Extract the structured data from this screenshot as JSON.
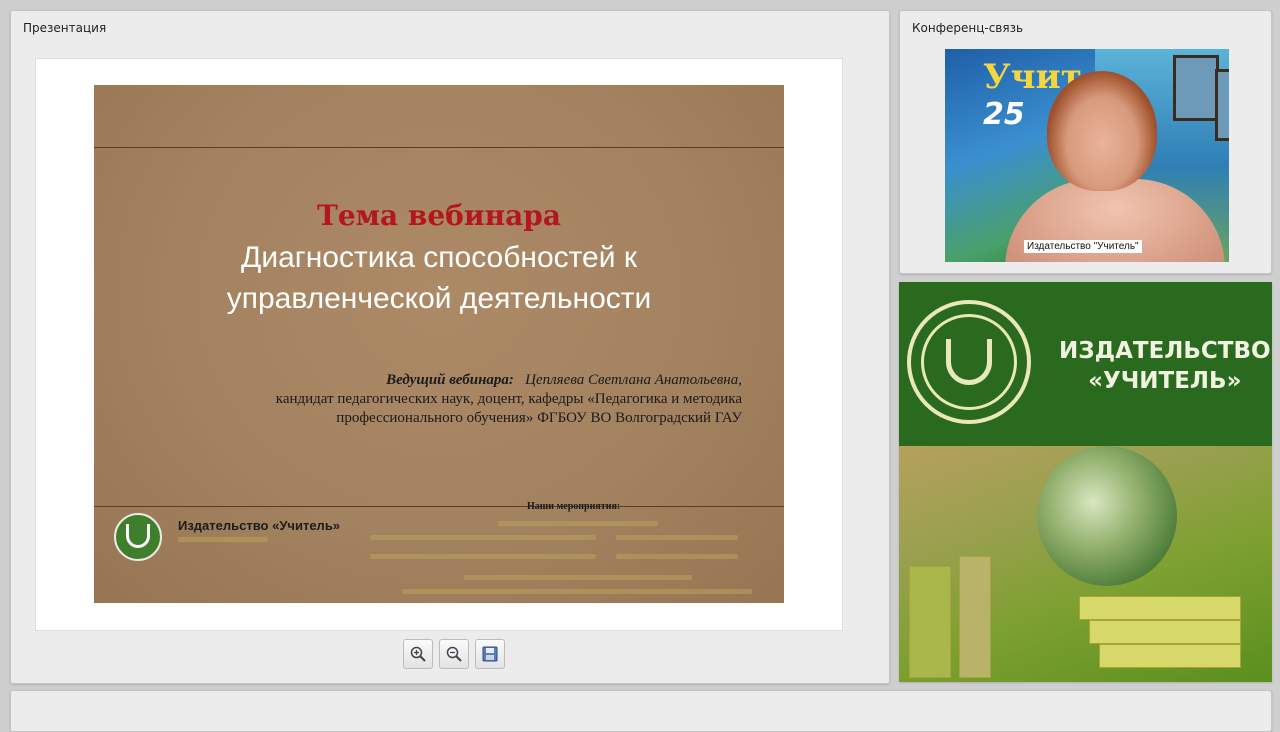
{
  "presentation_panel": {
    "title": "Презентация",
    "slide": {
      "heading": "Тема вебинара",
      "topic": "Диагностика способностей к управленческой деятельности",
      "presenter_label": "Ведущий вебинара",
      "presenter_name": "Цепляева Светлана Анатольевна,",
      "presenter_line2": "кандидат педагогических наук,  доцент, кафедры «Педагогика и методика",
      "presenter_line3": "профессионального обучения» ФГБОУ ВО Волгоградский ГАУ",
      "brand": "Издательство «Учитель»",
      "events_label": "Наши мероприятия:"
    },
    "toolbar": [
      {
        "icon": "zoom-in-icon"
      },
      {
        "icon": "zoom-out-icon"
      },
      {
        "icon": "save-icon"
      }
    ]
  },
  "conference_panel": {
    "title": "Конференц-связь",
    "video": {
      "poster_text": "Учит",
      "poster_number": "25",
      "caption": "Издательство \"Учитель\""
    }
  },
  "brand_panel": {
    "name_line1": "ИЗДАТЕЛЬСТВО",
    "name_line2": "«УЧИТЕЛЬ»"
  },
  "colors": {
    "slide_background": "#a38260",
    "slide_heading": "#b3161c",
    "brand_green": "#2a6a1e"
  }
}
